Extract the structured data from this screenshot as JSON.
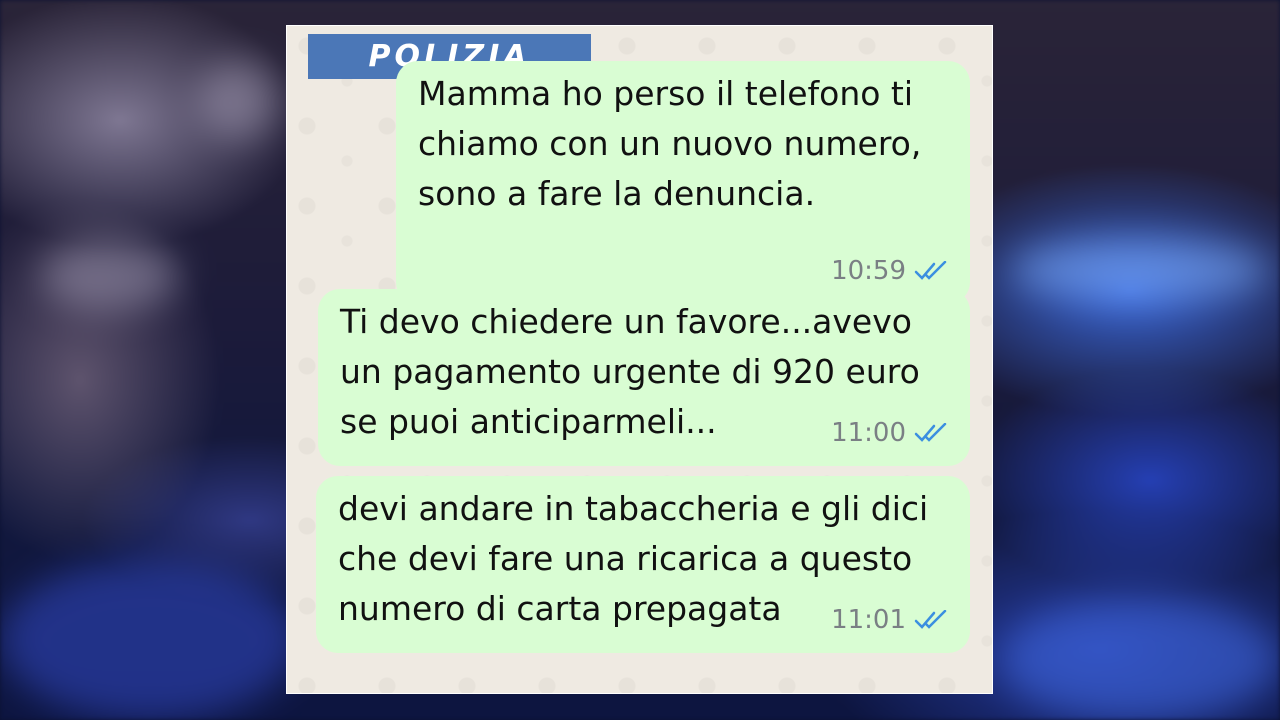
{
  "logo": {
    "text": "POLIZIA"
  },
  "messages": [
    {
      "text": "Mamma ho perso il telefono ti\nchiamo con un nuovo numero,\nsono a fare la denuncia.",
      "time": "10:59",
      "status_icon": "double-check-icon"
    },
    {
      "text": "Ti devo chiedere un favore...avevo\nun pagamento urgente di 920 euro\nse puoi anticiparmeli...",
      "time": "11:00",
      "status_icon": "double-check-icon"
    },
    {
      "text": "devi andare in tabaccheria e gli dici\nche devi fare una ricarica a questo\nnumero di carta prepagata",
      "time": "11:01",
      "status_icon": "double-check-icon"
    }
  ],
  "colors": {
    "bubble": "#d9fdd3",
    "chat_background": "#efeae2",
    "logo_background": "#4b77b7",
    "read_ticks": "#3b8fe0"
  }
}
